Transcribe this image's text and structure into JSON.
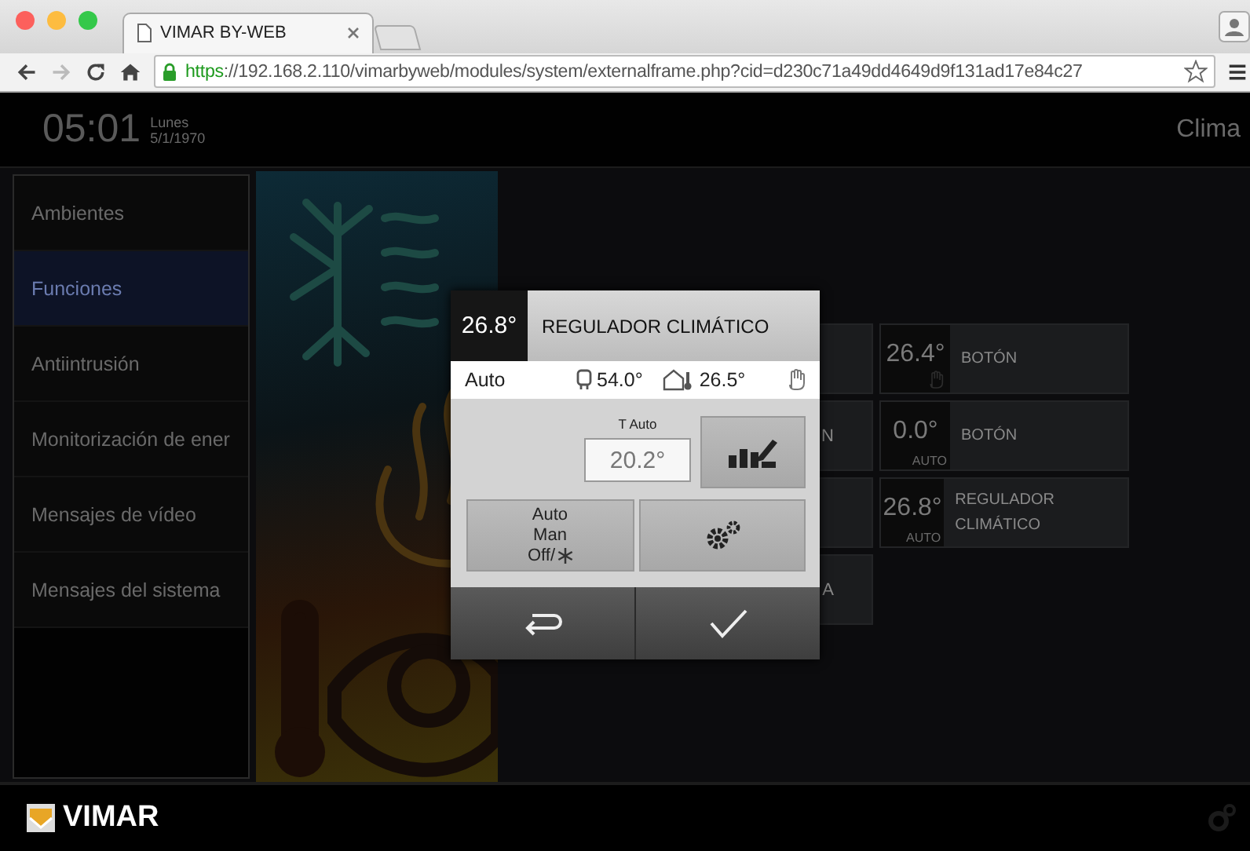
{
  "browser": {
    "tab_title": "VIMAR BY-WEB",
    "url": {
      "scheme": "https",
      "rest": "://192.168.2.110/vimarbyweb/modules/system/externalframe.php?cid=d230c71a49dd4649d9f131ad17e84c27"
    },
    "forward_disabled": true
  },
  "header": {
    "time": "05:01",
    "weekday": "Lunes",
    "date": "5/1/1970",
    "section": "Clima"
  },
  "sidebar": {
    "items": [
      {
        "label": "Ambientes",
        "selected": false
      },
      {
        "label": "Funciones",
        "selected": true
      },
      {
        "label": "Antiintrusión",
        "selected": false
      },
      {
        "label": "Monitorización de ener",
        "selected": false
      },
      {
        "label": "Mensajes de vídeo",
        "selected": false
      },
      {
        "label": "Mensajes del sistema",
        "selected": false
      }
    ]
  },
  "tiles": [
    {
      "kind": "partial"
    },
    {
      "kind": "manual",
      "value": "26.4°",
      "label": "BOTÓN"
    },
    {
      "kind": "partial",
      "label": "N"
    },
    {
      "kind": "auto",
      "value": "0.0°",
      "mode": "AUTO",
      "label": "BOTÓN"
    },
    {
      "kind": "partial"
    },
    {
      "kind": "auto",
      "value": "26.8°",
      "mode": "AUTO",
      "label": "REGULADOR CLIMÁTICO"
    },
    {
      "kind": "partial",
      "label": "A"
    }
  ],
  "dialog": {
    "value": "26.8°",
    "title": "REGULADOR CLIMÁTICO",
    "mode": "Auto",
    "boiler_temp": "54.0°",
    "room_temp": "26.5°",
    "manual": true,
    "setpoint_label": "T Auto",
    "setpoint": "20.2°",
    "mode_options": [
      "Auto",
      "Man",
      "Off/"
    ]
  },
  "footer": {
    "brand": "VIMAR"
  }
}
